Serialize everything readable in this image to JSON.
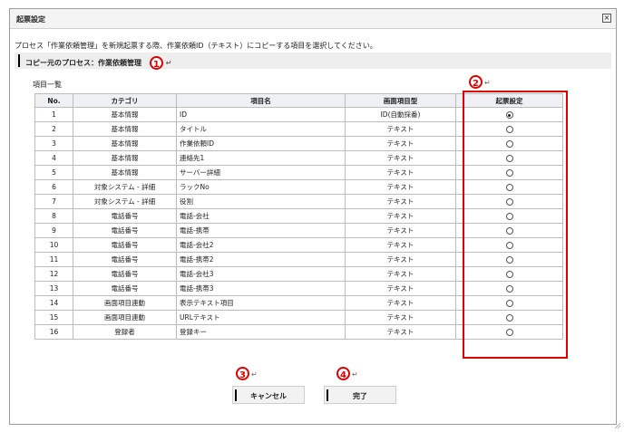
{
  "dialog": {
    "title": "起票設定",
    "description": "プロセス「作業依頼管理」を新規起票する際、作業依頼ID（テキスト）にコピーする項目を選択してください。",
    "copy_source_label": "コピー元のプロセス：作業依頼管理",
    "list_label": "項目一覧",
    "return_mark": "↵"
  },
  "callouts": [
    "1",
    "2",
    "3",
    "4"
  ],
  "table": {
    "headers": [
      "No.",
      "カテゴリ",
      "項目名",
      "画面項目型",
      "起票設定"
    ],
    "rows": [
      {
        "no": "1",
        "category": "基本情報",
        "item": "ID",
        "type": "ID(自動採番)",
        "selected": true
      },
      {
        "no": "2",
        "category": "基本情報",
        "item": "タイトル",
        "type": "テキスト",
        "selected": false
      },
      {
        "no": "3",
        "category": "基本情報",
        "item": "作業依頼ID",
        "type": "テキスト",
        "selected": false
      },
      {
        "no": "4",
        "category": "基本情報",
        "item": "連絡先1",
        "type": "テキスト",
        "selected": false
      },
      {
        "no": "5",
        "category": "基本情報",
        "item": "サーバー詳細",
        "type": "テキスト",
        "selected": false
      },
      {
        "no": "6",
        "category": "対象システム - 詳細",
        "item": "ラックNo",
        "type": "テキスト",
        "selected": false
      },
      {
        "no": "7",
        "category": "対象システム - 詳細",
        "item": "役割",
        "type": "テキスト",
        "selected": false
      },
      {
        "no": "8",
        "category": "電話番号",
        "item": "電話-会社",
        "type": "テキスト",
        "selected": false
      },
      {
        "no": "9",
        "category": "電話番号",
        "item": "電話-携帯",
        "type": "テキスト",
        "selected": false
      },
      {
        "no": "10",
        "category": "電話番号",
        "item": "電話-会社2",
        "type": "テキスト",
        "selected": false
      },
      {
        "no": "11",
        "category": "電話番号",
        "item": "電話-携帯2",
        "type": "テキスト",
        "selected": false
      },
      {
        "no": "12",
        "category": "電話番号",
        "item": "電話-会社3",
        "type": "テキスト",
        "selected": false
      },
      {
        "no": "13",
        "category": "電話番号",
        "item": "電話-携帯3",
        "type": "テキスト",
        "selected": false
      },
      {
        "no": "14",
        "category": "画面項目連動",
        "item": "表示テキスト項目",
        "type": "テキスト",
        "selected": false
      },
      {
        "no": "15",
        "category": "画面項目連動",
        "item": "URLテキスト",
        "type": "テキスト",
        "selected": false
      },
      {
        "no": "16",
        "category": "登録者",
        "item": "登録キー",
        "type": "テキスト",
        "selected": false
      }
    ]
  },
  "buttons": {
    "cancel": "キャンセル",
    "done": "完了"
  },
  "colors": {
    "accent_red": "#e00000",
    "header_bg": "#eef0f3",
    "section_bg": "#eeeeee"
  },
  "icons": {
    "close": "close-icon",
    "resize": "resize-grip-icon",
    "radio": "radio-icon"
  }
}
